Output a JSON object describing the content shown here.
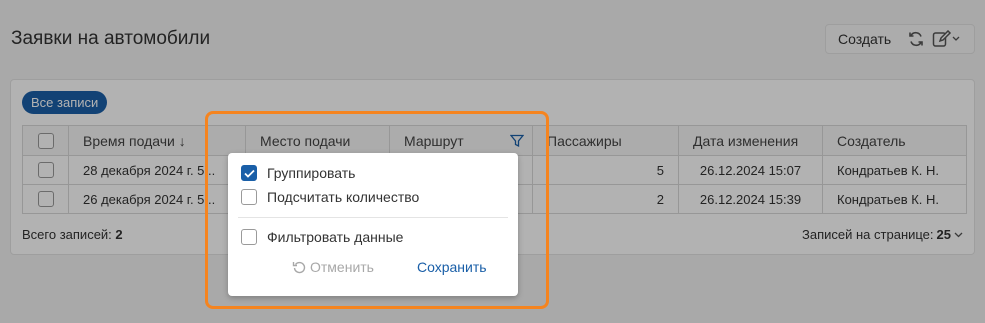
{
  "page": {
    "title": "Заявки на автомобили"
  },
  "toolbar": {
    "create_label": "Создать",
    "icons": [
      "refresh-icon",
      "edit-icon",
      "chevron-down-icon"
    ]
  },
  "filter_chip": {
    "label": "Все записи"
  },
  "table": {
    "columns": [
      "Время подачи",
      "Место подачи",
      "Маршрут",
      "Пассажиры",
      "Дата изменения",
      "Создатель"
    ],
    "sort_indicator": "↓",
    "rows": [
      {
        "time": "28 декабря 2024 г.   5...",
        "place": "",
        "route": "",
        "passengers": "5",
        "modified": "26.12.2024 15:07",
        "creator": "Кондратьев К. Н."
      },
      {
        "time": "26 декабря 2024 г.   5...",
        "place": "",
        "route": "",
        "passengers": "2",
        "modified": "26.12.2024 15:39",
        "creator": "Кондратьев К. Н."
      }
    ]
  },
  "footer": {
    "total_label": "Всего записей:",
    "total_value": "2",
    "per_page_label": "Записей на странице:",
    "per_page_value": "25"
  },
  "popup": {
    "group_label": "Группировать",
    "group_checked": true,
    "count_label": "Подсчитать количество",
    "count_checked": false,
    "filter_label": "Фильтровать данные",
    "filter_checked": false,
    "cancel_label": "Отменить",
    "save_label": "Сохранить"
  },
  "colors": {
    "accent": "#1a5fa8",
    "highlight": "#f5841f"
  }
}
